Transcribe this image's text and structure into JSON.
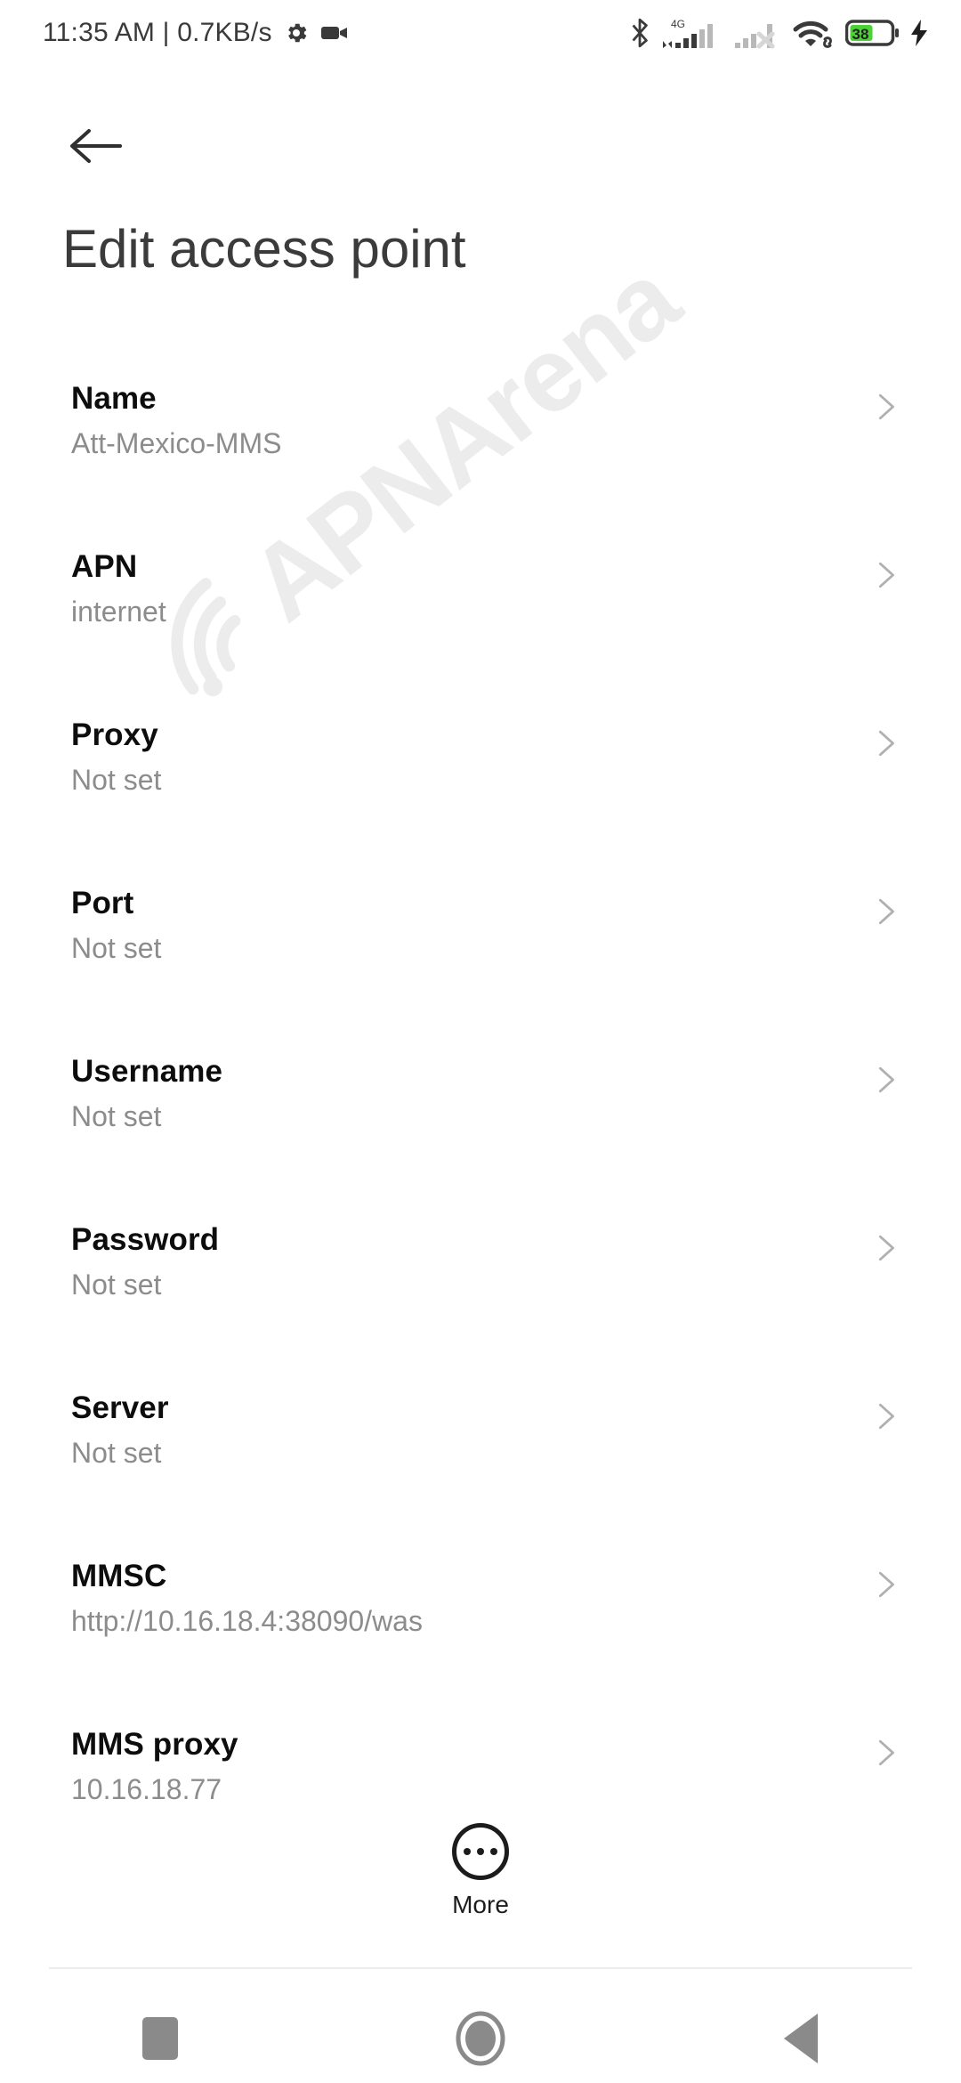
{
  "statusbar": {
    "clock": "11:35 AM | 0.7KB/s",
    "network_label": "4G",
    "battery_level": "38",
    "icons": [
      "gear-icon",
      "camcorder-icon",
      "bluetooth-icon",
      "signal-4g-icon",
      "signal-sim2-off-icon",
      "wifi-icon",
      "battery-icon",
      "charging-bolt-icon"
    ],
    "colors": {
      "text": "#3a3a3a",
      "battery_fill": "#4cd137"
    }
  },
  "header": {
    "back_label": "Back",
    "title": "Edit access point"
  },
  "list": {
    "rows": [
      {
        "label": "Name",
        "value": "Att-Mexico-MMS"
      },
      {
        "label": "APN",
        "value": "internet"
      },
      {
        "label": "Proxy",
        "value": "Not set"
      },
      {
        "label": "Port",
        "value": "Not set"
      },
      {
        "label": "Username",
        "value": "Not set"
      },
      {
        "label": "Password",
        "value": "Not set"
      },
      {
        "label": "Server",
        "value": "Not set"
      },
      {
        "label": "MMSC",
        "value": "http://10.16.18.4:38090/was"
      },
      {
        "label": "MMS proxy",
        "value": "10.16.18.77"
      }
    ]
  },
  "more_button": {
    "label": "More",
    "icon": "three-dots-circle-icon"
  },
  "navbar": {
    "recents_label": "Recents",
    "home_label": "Home",
    "back_label": "Back",
    "color": "#8a8a8a"
  },
  "watermark": {
    "text": "APNArena",
    "color": "#ececec"
  }
}
